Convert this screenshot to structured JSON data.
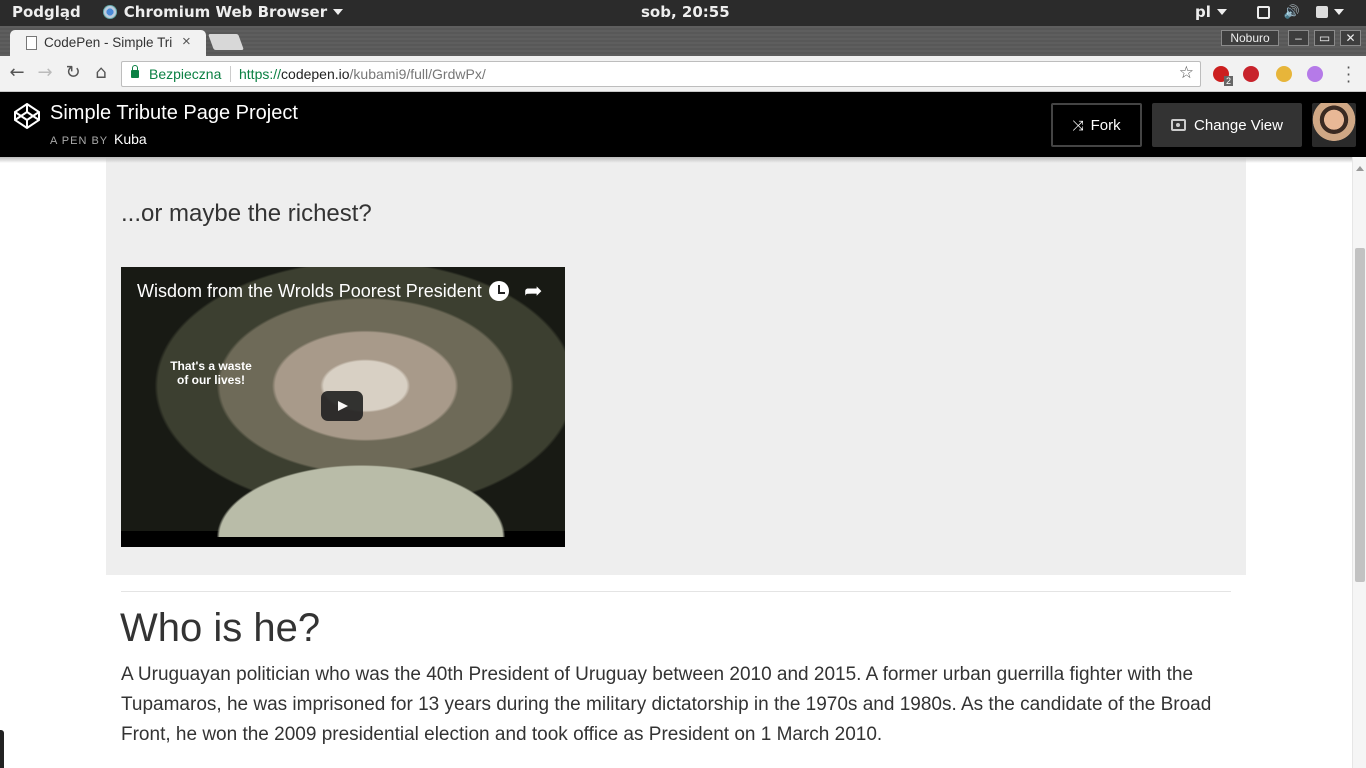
{
  "os_panel": {
    "menu_label": "Podgląd",
    "app_name": "Chromium Web Browser",
    "clock": "sob, 20:55",
    "keyboard_layout": "pl"
  },
  "browser": {
    "tab_title": "CodePen - Simple Tribute Page Project",
    "tab_close": "×",
    "profile_name": "Noburo",
    "window_min": "–",
    "window_max": "▭",
    "window_close": "✕",
    "secure_label": "Bezpieczna",
    "url_scheme": "https://",
    "url_host": "codepen.io",
    "url_path": "/kubami9/full/GrdwPx/",
    "extension_badge": "2"
  },
  "codepen": {
    "pen_title": "Simple Tribute Page Project",
    "by_label": "A PEN BY",
    "author": "Kuba",
    "fork_label": "Fork",
    "change_view_label": "Change View"
  },
  "content": {
    "subheading": "...or maybe the richest?",
    "video": {
      "title": "Wisdom from the Wrolds Poorest President",
      "caption": "That's a waste of our lives!"
    },
    "section_heading": "Who is he?",
    "section_text": "A Uruguayan politician who was the 40th President of Uruguay between 2010 and 2015. A former urban guerrilla fighter with the Tupamaros, he was imprisoned for 13 years during the military dictatorship in the 1970s and 1980s. As the candidate of the Broad Front, he won the 2009 presidential election and took office as President on 1 March 2010."
  },
  "colors": {
    "secure_green": "#0b8043",
    "codepen_header": "#000000",
    "jumbotron_bg": "#eeeeee"
  }
}
